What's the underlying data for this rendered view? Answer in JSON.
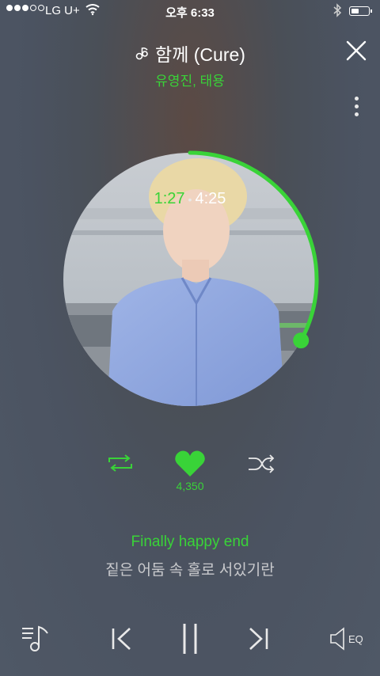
{
  "status_bar": {
    "carrier": "LG U+",
    "time": "오후 6:33",
    "signal_bars_filled": 3,
    "signal_bars_total": 5,
    "battery_level": 0.35
  },
  "header": {
    "song_title": "함께 (Cure)",
    "artist": "유영진, 태용"
  },
  "player": {
    "current_time": "1:27",
    "separator": "•",
    "total_time": "4:25",
    "progress": 0.33,
    "like_count": "4,350"
  },
  "lyrics": {
    "current_line": "Finally happy end",
    "next_line": "짙은 어둠 속 홀로 서있기란"
  },
  "controls": {
    "eq_label": "EQ"
  },
  "colors": {
    "accent": "#39d338",
    "text": "#ffffff",
    "muted_text": "#c9cacd"
  },
  "icons": {
    "title_note": "note-icon",
    "close": "close-icon",
    "more": "more-vertical-icon",
    "repeat": "repeat-icon",
    "like": "heart-icon",
    "shuffle": "shuffle-icon",
    "playlist": "playlist-icon",
    "prev": "previous-icon",
    "pause": "pause-icon",
    "next": "next-icon",
    "eq": "speaker-icon"
  }
}
